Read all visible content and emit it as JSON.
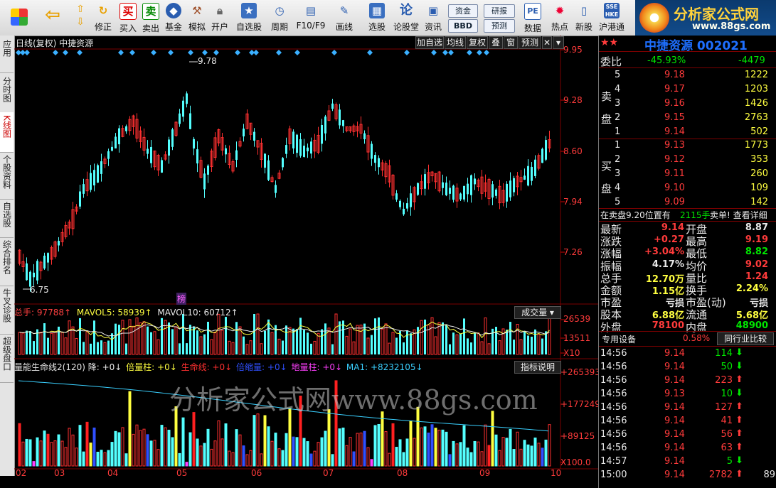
{
  "toolbar": {
    "buttons": [
      {
        "label": "",
        "icon": "windows-grid-icon"
      },
      {
        "label": "",
        "icon": "back-arrow-icon"
      },
      {
        "label": "修正",
        "icon": "refresh-icon"
      },
      {
        "label": "买入",
        "icon": "buy-icon",
        "glyph": "买"
      },
      {
        "label": "卖出",
        "icon": "sell-icon",
        "glyph": "卖"
      },
      {
        "label": "基金",
        "icon": "fund-icon"
      },
      {
        "label": "模拟",
        "icon": "hammer-icon"
      },
      {
        "label": "开户",
        "icon": "lock-icon"
      },
      {
        "label": "自选股",
        "icon": "star-folder-icon"
      },
      {
        "label": "周期",
        "icon": "clock-icon"
      },
      {
        "label": "F10/F9",
        "icon": "f10-icon"
      },
      {
        "label": "画线",
        "icon": "pen-icon"
      },
      {
        "label": "选股",
        "icon": "stock-pick-icon"
      },
      {
        "label": "论股堂",
        "icon": "forum-icon",
        "glyph": "论"
      },
      {
        "label": "资讯",
        "icon": "news-icon"
      },
      {
        "label": "数据",
        "icon": "pe-data-icon",
        "glyph": "PE"
      },
      {
        "label": "热点",
        "icon": "hot-icon"
      },
      {
        "label": "新股",
        "icon": "ipo-icon"
      },
      {
        "label": "沪港通",
        "icon": "sse-hkex-icon"
      }
    ],
    "pills": {
      "funds": "资金",
      "research": "研报",
      "bbd": "BBD",
      "forecast": "预测"
    }
  },
  "logo": {
    "title": "分析家公式网",
    "url": "www.88gs.com"
  },
  "sidebar": [
    "应用",
    "分时图",
    "K线图",
    "个股资料",
    "自选股",
    "综合排名",
    "牛叉诊股",
    "超级盘口"
  ],
  "chart": {
    "title": "日线(复权)  中捷资源",
    "buttons": [
      "加自选",
      "均线",
      "复权",
      "叠",
      "窗",
      "预测"
    ],
    "price_axis": [
      "9.95",
      "9.28",
      "8.60",
      "7.94",
      "7.26"
    ],
    "high_label": "9.78",
    "low_label": "6.75",
    "bang_label": "榜",
    "volume": {
      "legend": [
        {
          "text": "总手: 97788↑",
          "color": "#ff4040"
        },
        {
          "text": "MAVOL5: 58939↑",
          "color": "#ffff40"
        },
        {
          "text": "MAVOL10: 60712↑",
          "color": "#e8e8e8"
        }
      ],
      "button": "成交量",
      "axis": [
        "26539",
        "13511",
        "X10"
      ]
    },
    "indicator": {
      "legend": [
        {
          "text": "量能生命线2(120) 降: +0↓",
          "color": "#e8e8e8"
        },
        {
          "text": "倍量柱: +0↓",
          "color": "#ffff40"
        },
        {
          "text": "生命线: +0↓",
          "color": "#ff3030"
        },
        {
          "text": "倍缩量: +0↓",
          "color": "#3050ff"
        },
        {
          "text": "地量柱: +0↓",
          "color": "#ff40ff"
        },
        {
          "text": "MA1: +8232105↓",
          "color": "#3ad0ff"
        }
      ],
      "button": "指标说明",
      "axis": [
        "+265393",
        "+177249",
        "+89125",
        "X100.0"
      ],
      "watermark": "分析家公式网www.88gs.com"
    },
    "months": [
      "02",
      "03",
      "04",
      "05",
      "06",
      "07",
      "08",
      "09",
      "10"
    ],
    "colors": {
      "up": "#ff3030",
      "down": "#54ffff",
      "ma": "#3ad0ff"
    }
  },
  "quote": {
    "title": "中捷资源 002021",
    "webi": {
      "label": "委比",
      "pct": "-45.93%",
      "diff": "-4479"
    },
    "sell_label": "卖盘",
    "buy_label": "买盘",
    "sell": [
      {
        "n": "5",
        "p": "9.18",
        "v": "1222"
      },
      {
        "n": "4",
        "p": "9.17",
        "v": "1203"
      },
      {
        "n": "3",
        "p": "9.16",
        "v": "1426"
      },
      {
        "n": "2",
        "p": "9.15",
        "v": "2763"
      },
      {
        "n": "1",
        "p": "9.14",
        "v": "502"
      }
    ],
    "buy": [
      {
        "n": "1",
        "p": "9.13",
        "v": "1773"
      },
      {
        "n": "2",
        "p": "9.12",
        "v": "353"
      },
      {
        "n": "3",
        "p": "9.11",
        "v": "260"
      },
      {
        "n": "4",
        "p": "9.10",
        "v": "109"
      },
      {
        "n": "5",
        "p": "9.09",
        "v": "142"
      }
    ],
    "notice": {
      "a": "在卖盘9.20位置有",
      "b": "2115手",
      "c": "卖单! 查看详细"
    },
    "stats": [
      {
        "l": "最新",
        "v": "9.14",
        "l2": "开盘",
        "v2": "8.87",
        "c": "red",
        "c2": "wht"
      },
      {
        "l": "涨跌",
        "v": "+0.27",
        "l2": "最高",
        "v2": "9.19",
        "c": "red",
        "c2": "red"
      },
      {
        "l": "涨幅",
        "v": "+3.04%",
        "l2": "最低",
        "v2": "8.82",
        "c": "red",
        "c2": "grn"
      },
      {
        "l": "振幅",
        "v": "4.17%",
        "l2": "均价",
        "v2": "9.02",
        "c": "wht",
        "c2": "red"
      },
      {
        "l": "总手",
        "v": "12.70万",
        "l2": "量比",
        "v2": "1.24",
        "c": "yel",
        "c2": "red"
      },
      {
        "l": "金额",
        "v": "1.15亿",
        "l2": "换手",
        "v2": "2.24%",
        "c": "yel",
        "c2": "yel"
      },
      {
        "l": "市盈",
        "v": "亏损",
        "l2": "市盈(动)",
        "v2": "亏损",
        "c": "wht",
        "c2": "wht"
      },
      {
        "l": "股本",
        "v": "6.88亿",
        "l2": "流通",
        "v2": "5.68亿",
        "c": "yel",
        "c2": "yel"
      },
      {
        "l": "外盘",
        "v": "78100",
        "l2": "内盘",
        "v2": "48900",
        "c": "red",
        "c2": "grn"
      }
    ],
    "industry": {
      "name": "专用设备",
      "pct": "0.58%",
      "button": "同行业比较"
    },
    "ticks": [
      {
        "t": "14:56",
        "p": "9.14",
        "v": "114",
        "d": "down"
      },
      {
        "t": "14:56",
        "p": "9.14",
        "v": "50",
        "d": "down"
      },
      {
        "t": "14:56",
        "p": "9.14",
        "v": "223",
        "d": "up"
      },
      {
        "t": "14:56",
        "p": "9.13",
        "v": "10",
        "d": "down"
      },
      {
        "t": "14:56",
        "p": "9.14",
        "v": "127",
        "d": "up"
      },
      {
        "t": "14:56",
        "p": "9.14",
        "v": "41",
        "d": "up"
      },
      {
        "t": "14:56",
        "p": "9.14",
        "v": "56",
        "d": "up"
      },
      {
        "t": "14:56",
        "p": "9.14",
        "v": "63",
        "d": "up"
      },
      {
        "t": "14:57",
        "p": "9.14",
        "v": "5",
        "d": "down"
      },
      {
        "t": "15:00",
        "p": "9.14",
        "v": "2782",
        "d": "up",
        "extra": "89"
      }
    ]
  }
}
